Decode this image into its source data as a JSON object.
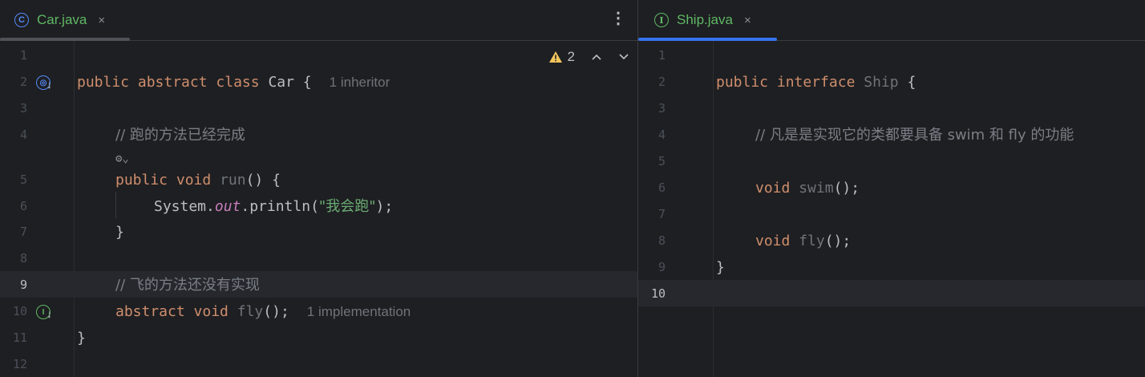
{
  "left_tab": {
    "label": "Car.java",
    "icon": "class-icon",
    "close": "×"
  },
  "right_tab": {
    "label": "Ship.java",
    "icon": "interface-icon",
    "close": "×"
  },
  "kebab_icon": "⋮",
  "inspection": {
    "warnings": "2"
  },
  "left": {
    "line_numbers": [
      "1",
      "2",
      "3",
      "4",
      "5",
      "6",
      "7",
      "8",
      "9",
      "10",
      "11",
      "12"
    ],
    "l2": {
      "public": "public",
      "abstract": "abstract",
      "class": "class",
      "name": " Car",
      "brace": " {",
      "inlay": "1 inheritor"
    },
    "l4": {
      "comment": "// 跑的方法已经完成"
    },
    "l5": {
      "public": "public",
      "void": "void",
      "name": "run",
      "rest": "() {"
    },
    "l6": {
      "system": "System.",
      "out": "out",
      "println": ".println(",
      "str": "\"我会跑\"",
      "end": ");"
    },
    "l7": {
      "brace": "}"
    },
    "l9": {
      "comment": "// 飞的方法还没有实现"
    },
    "l10": {
      "abstract": "abstract",
      "void": "void",
      "name": "fly",
      "rest": "();",
      "inlay": "1 implementation"
    },
    "l11": {
      "brace": "}"
    }
  },
  "right": {
    "line_numbers": [
      "1",
      "2",
      "3",
      "4",
      "5",
      "6",
      "7",
      "8",
      "9",
      "10"
    ],
    "l2": {
      "public": "public",
      "interface": "interface",
      "name": " Ship",
      "brace": " {"
    },
    "l4": {
      "comment": "// 凡是是实现它的类都要具备 swim 和 fly 的功能"
    },
    "l6": {
      "void": "void",
      "name": "swim",
      "rest": "();"
    },
    "l8": {
      "void": "void",
      "name": "fly",
      "rest": "();"
    },
    "l9": {
      "brace": "}"
    }
  },
  "colors": {
    "keyword": "#cf8e6d",
    "string": "#6aab73",
    "comment": "#7a7e85",
    "tab_active": "#3574f0",
    "tab_label": "#5fb865"
  }
}
